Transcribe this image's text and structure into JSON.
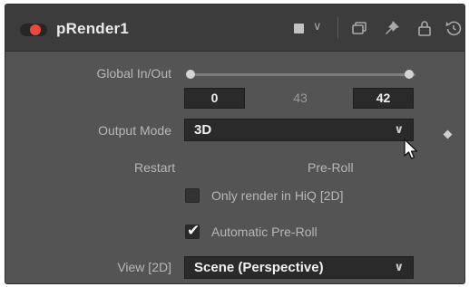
{
  "header": {
    "node_name": "pRender1",
    "icons": [
      "color-chip",
      "chevron-down-icon",
      "versions-icon",
      "pin-icon",
      "lock-icon",
      "reset-icon"
    ],
    "chevron": "∨"
  },
  "global_inout": {
    "label": "Global In/Out",
    "in_value": "0",
    "mid_value": "43",
    "out_value": "42"
  },
  "output_mode": {
    "label": "Output Mode",
    "value": "3D",
    "chevron": "∨"
  },
  "tabs": {
    "restart": "Restart",
    "preroll": "Pre-Roll"
  },
  "checkboxes": [
    {
      "label": "Only render in HiQ [2D]",
      "checked": false,
      "mark": ""
    },
    {
      "label": "Automatic Pre-Roll",
      "checked": true,
      "mark": "✔"
    }
  ],
  "view": {
    "label": "View [2D]",
    "value": "Scene (Perspective)",
    "chevron": "∨"
  },
  "colors": {
    "panel_bg": "#545454",
    "header_bg": "#3c3c3c",
    "field_bg": "#2a2a2a",
    "toggle_red": "#e8493c",
    "label_text": "#b7b7b7"
  }
}
